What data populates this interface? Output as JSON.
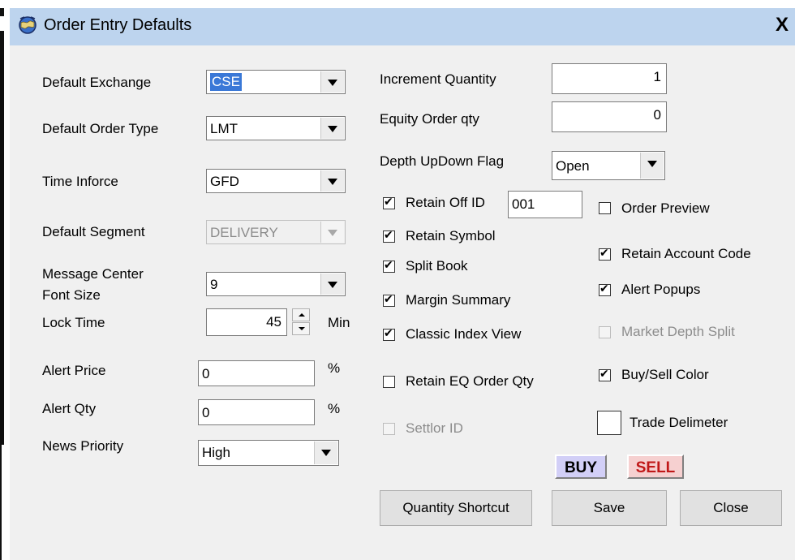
{
  "window": {
    "title": "Order Entry Defaults",
    "close": "X"
  },
  "left": {
    "default_exchange": {
      "label": "Default Exchange",
      "value": "CSE"
    },
    "default_order_type": {
      "label": "Default Order Type",
      "value": "LMT"
    },
    "time_inforce": {
      "label": "Time Inforce",
      "value": "GFD"
    },
    "default_segment": {
      "label": "Default Segment",
      "value": "DELIVERY"
    },
    "message_center_font_size": {
      "label_line1": "Message Center",
      "label_line2": "Font Size",
      "value": "9"
    },
    "lock_time": {
      "label": "Lock Time",
      "value": "45",
      "unit": "Min"
    },
    "alert_price": {
      "label": "Alert Price",
      "value": "0",
      "unit": "%"
    },
    "alert_qty": {
      "label": "Alert Qty",
      "value": "0",
      "unit": "%"
    },
    "news_priority": {
      "label": "News Priority",
      "value": "High"
    }
  },
  "right": {
    "increment_quantity": {
      "label": "Increment Quantity",
      "value": "1"
    },
    "equity_order_qty": {
      "label": "Equity Order qty",
      "value": "0"
    },
    "depth_updown_flag": {
      "label": "Depth UpDown Flag",
      "value": "Open"
    },
    "retain_off_id": {
      "label": "Retain Off ID",
      "value": "001",
      "checked": true
    },
    "order_preview": {
      "label": "Order Preview",
      "checked": false
    },
    "retain_symbol": {
      "label": "Retain Symbol",
      "checked": true
    },
    "retain_account_code": {
      "label": "Retain Account Code",
      "checked": true
    },
    "split_book": {
      "label": "Split Book",
      "checked": true
    },
    "alert_popups": {
      "label": "Alert Popups",
      "checked": true
    },
    "margin_summary": {
      "label": "Margin Summary",
      "checked": true
    },
    "classic_index_view": {
      "label": "Classic Index View",
      "checked": true
    },
    "market_depth_split": {
      "label": "Market Depth Split",
      "checked": false,
      "disabled": true
    },
    "retain_eq_order_qty": {
      "label": "Retain EQ Order Qty",
      "checked": false
    },
    "buy_sell_color": {
      "label": "Buy/Sell Color",
      "checked": true
    },
    "settlor_id": {
      "label": "Settlor ID",
      "checked": false,
      "disabled": true
    },
    "trade_delimeter": {
      "label": "Trade Delimeter",
      "checked": false
    }
  },
  "colors": {
    "buy_bg": "#d2cff7",
    "sell_bg": "#f6d0d0",
    "sell_text": "#c01818",
    "titlebar": "#bdd4ee",
    "selection": "#3a78d7"
  },
  "buttons": {
    "buy": "BUY",
    "sell": "SELL",
    "quantity_shortcut": "Quantity Shortcut",
    "save": "Save",
    "close": "Close"
  }
}
